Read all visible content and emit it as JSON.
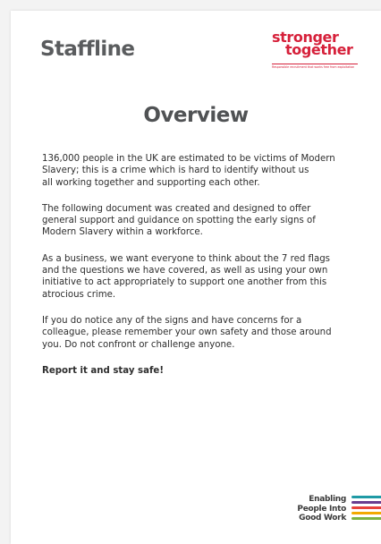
{
  "header": {
    "staffline_logo": "Staffline",
    "partner_logo": {
      "line1": "stronger",
      "line2": "together",
      "tagline": "Responsible recruitment that works free from exploitation",
      "color": "#d6203a"
    }
  },
  "title": "Overview",
  "paragraphs": [
    "136,000 people in the UK are estimated to be victims of Modern\nSlavery; this is a crime which is hard to identify without us\nall working together and supporting each other.",
    "The following document was created and designed to offer\ngeneral support and guidance on spotting the early signs of\nModern Slavery within a workforce.",
    "As a business, we want everyone to think about the 7 red flags\nand the questions we have covered, as well as using your own\ninitiative to act appropriately to support one another from this\natrocious crime.",
    "If you do notice any of the signs and have concerns for a\ncolleague, please remember your own safety and those around\nyou. Do not confront or challenge anyone.",
    "Report it and stay safe!"
  ],
  "footer": {
    "logo_lines": [
      "Enabling",
      "People Into",
      "Good Work"
    ],
    "stripe_colors": [
      "#1f9aa5",
      "#6a3d8f",
      "#e8423b",
      "#f2a900",
      "#7cb342"
    ]
  }
}
